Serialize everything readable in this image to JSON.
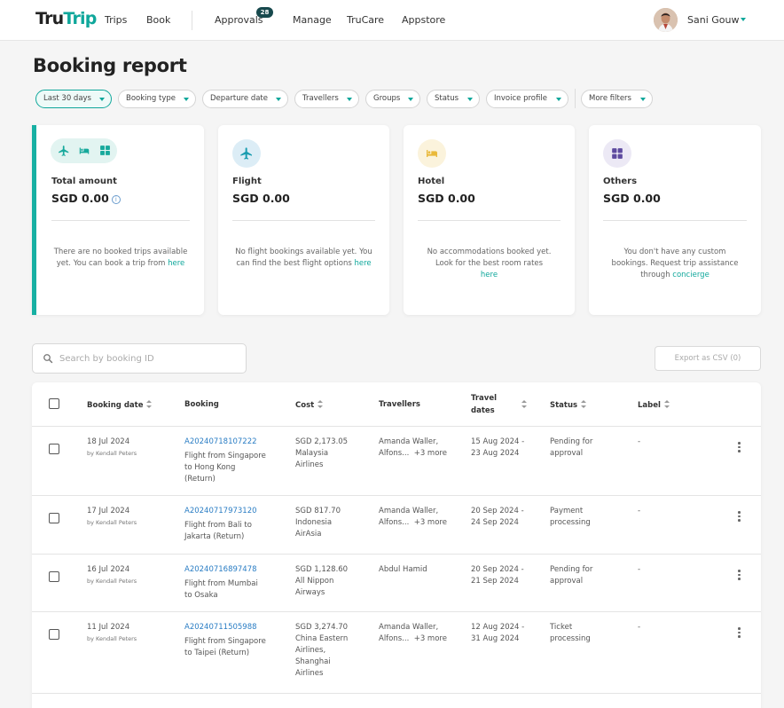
{
  "nav": {
    "logo_part1": "Tru",
    "logo_part2": "Trip",
    "items": [
      {
        "label": "Trips"
      },
      {
        "label": "Book"
      },
      {
        "label": "Approvals",
        "badge": "28"
      },
      {
        "label": "Manage"
      },
      {
        "label": "TruCare"
      },
      {
        "label": "Appstore"
      }
    ],
    "user_name": "Sani Gouw",
    "accent_color": "#0fa79b"
  },
  "page_title": "Booking report",
  "filters": [
    {
      "label": "Last 30 days",
      "active": true
    },
    {
      "label": "Booking type"
    },
    {
      "label": "Departure date"
    },
    {
      "label": "Travellers"
    },
    {
      "label": "Groups"
    },
    {
      "label": "Status"
    },
    {
      "label": "Invoice profile"
    },
    {
      "label": "More filters"
    }
  ],
  "cards": {
    "total": {
      "label": "Total amount",
      "amount": "SGD 0.00",
      "msg": "There are no booked trips available yet. You can book a trip from",
      "link": "here",
      "icons": [
        "plane-icon",
        "bed-icon",
        "grid-icon"
      ]
    },
    "flight": {
      "label": "Flight",
      "amount": "SGD 0.00",
      "msg": "No flight bookings available yet. You can find the best flight options",
      "link": "here",
      "icon": "plane-icon",
      "color": "#1a9db0"
    },
    "hotel": {
      "label": "Hotel",
      "amount": "SGD 0.00",
      "msg": "No accommodations booked yet. Look for the best room rates",
      "link": "here",
      "icon": "bed-icon",
      "color": "#e9b93a"
    },
    "others": {
      "label": "Others",
      "amount": "SGD 0.00",
      "msg": "You don't have any custom bookings. Request trip assistance through",
      "link": "concierge",
      "icon": "grid-icon",
      "color": "#5d4a9f"
    }
  },
  "search": {
    "placeholder": "Search by booking ID"
  },
  "export_label": "Export as CSV (0)",
  "table": {
    "headers": {
      "booking_date": "Booking date",
      "booking": "Booking",
      "cost": "Cost",
      "travellers": "Travellers",
      "travel_dates_1": "Travel",
      "travel_dates_2": "dates",
      "status": "Status",
      "label": "Label"
    },
    "rows": [
      {
        "date": "18 Jul 2024",
        "by": "by Kendall Peters",
        "id": "A20240718107222",
        "desc": [
          "Flight from Singapore",
          "to Hong Kong",
          "(Return)"
        ],
        "cost": "SGD 2,173.05",
        "airline": [
          "Malaysia",
          "Airlines"
        ],
        "travellers": [
          "Amanda Waller,",
          "Alfons..."
        ],
        "more": "+3 more",
        "dates": [
          "15 Aug 2024 -",
          "23 Aug 2024"
        ],
        "status": [
          "Pending for",
          "approval"
        ],
        "label": "-"
      },
      {
        "date": "17 Jul 2024",
        "by": "by Kendall Peters",
        "id": "A20240717973120",
        "desc": [
          "Flight from Bali to",
          "Jakarta (Return)"
        ],
        "cost": "SGD 817.70",
        "airline": [
          "Indonesia",
          "AirAsia"
        ],
        "travellers": [
          "Amanda Waller,",
          "Alfons..."
        ],
        "more": "+3 more",
        "dates": [
          "20 Sep 2024 -",
          "24 Sep 2024"
        ],
        "status": [
          "Payment",
          "processing"
        ],
        "label": "-"
      },
      {
        "date": "16 Jul 2024",
        "by": "by Kendall Peters",
        "id": "A20240716897478",
        "desc": [
          "Flight from Mumbai",
          "to Osaka"
        ],
        "cost": "SGD 1,128.60",
        "airline": [
          "All Nippon",
          "Airways"
        ],
        "travellers": [
          "Abdul Hamid"
        ],
        "more": "",
        "dates": [
          "20 Sep 2024 -",
          "21 Sep 2024"
        ],
        "status": [
          "Pending for",
          "approval"
        ],
        "label": "-"
      },
      {
        "date": "11 Jul 2024",
        "by": "by Kendall Peters",
        "id": "A20240711505988",
        "desc": [
          "Flight from Singapore",
          "to Taipei (Return)"
        ],
        "cost": "SGD 3,274.70",
        "airline": [
          "China Eastern",
          "Airlines,",
          "Shanghai",
          "Airlines"
        ],
        "travellers": [
          "Amanda Waller,",
          "Alfons..."
        ],
        "more": "+3 more",
        "dates": [
          "12 Aug 2024 -",
          "31 Aug 2024"
        ],
        "status": [
          "Ticket",
          "processing"
        ],
        "label": "-"
      }
    ]
  }
}
